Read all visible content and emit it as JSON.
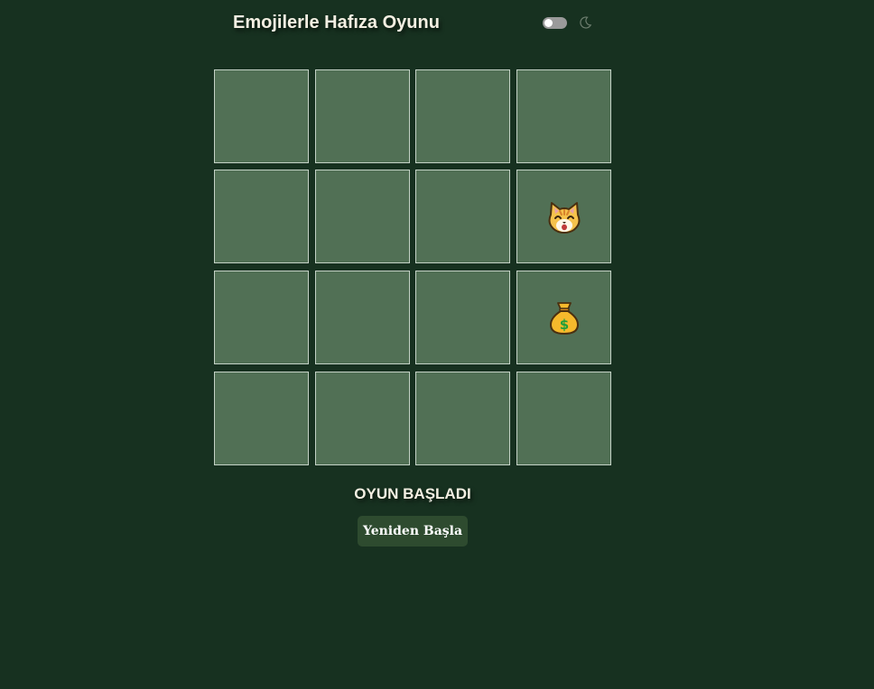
{
  "header": {
    "title": "Emojilerle Hafıza Oyunu",
    "theme_toggle_state": "off",
    "theme_icon": "moon-icon"
  },
  "board": {
    "rows": 4,
    "columns": 4,
    "cards": [
      {
        "face": "hidden"
      },
      {
        "face": "hidden"
      },
      {
        "face": "hidden"
      },
      {
        "face": "hidden"
      },
      {
        "face": "hidden"
      },
      {
        "face": "hidden"
      },
      {
        "face": "hidden"
      },
      {
        "face": "cat-face-icon"
      },
      {
        "face": "hidden"
      },
      {
        "face": "hidden"
      },
      {
        "face": "hidden"
      },
      {
        "face": "money-bag-icon"
      },
      {
        "face": "hidden"
      },
      {
        "face": "hidden"
      },
      {
        "face": "hidden"
      },
      {
        "face": "hidden"
      }
    ]
  },
  "status": {
    "text": "OYUN BAŞLADI"
  },
  "controls": {
    "restart_label": "Yeniden Başla"
  },
  "colors": {
    "background": "#173120",
    "card": "#517055",
    "card_border": "#c4d2c6",
    "button": "#2e4b2f",
    "text": "#f3efe2"
  }
}
